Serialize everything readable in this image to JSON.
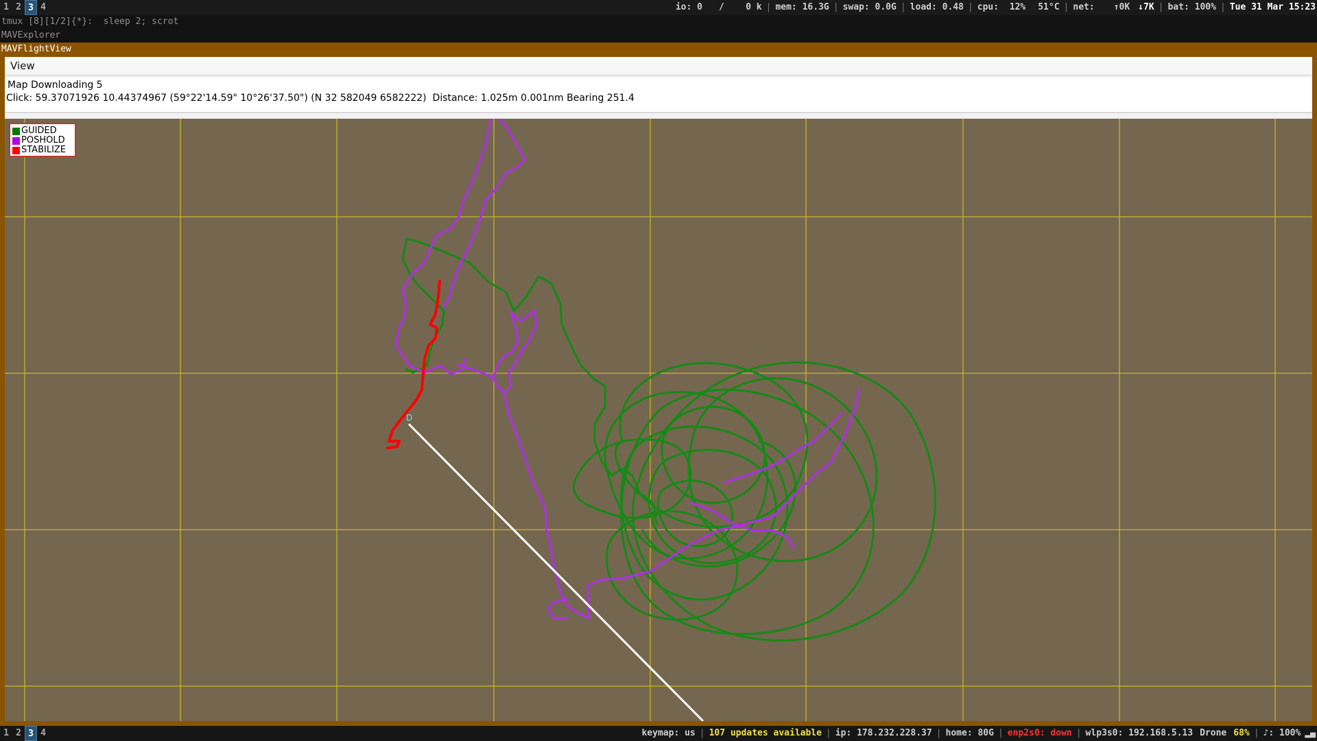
{
  "topbar": {
    "workspaces": [
      {
        "label": "1",
        "active": false
      },
      {
        "label": "2",
        "active": false
      },
      {
        "label": "3",
        "active": true
      },
      {
        "label": "4",
        "active": false
      }
    ],
    "io": "io: 0",
    "io_rate": "/    0 k",
    "mem": "mem: 16.3G",
    "swap": "swap: 0.0G",
    "load": "load: 0.48",
    "cpu": "cpu:  12%",
    "temp": "51°C",
    "net": "net:",
    "net_up": "↑0K",
    "net_down": "↓7K",
    "bat": "bat: 100%",
    "datetime": "Tue 31 Mar 15:23"
  },
  "tmux": {
    "line1": "tmux [8][1/2]{*}:  sleep 2; scrot",
    "line2": "MAVExplorer"
  },
  "window": {
    "title": "MAVFlightView"
  },
  "app": {
    "menu": [
      "View"
    ],
    "status_line1": "Map Downloading 5",
    "status_line2": "Click: 59.37071926 10.44374967 (59°22'14.59\" 10°26'37.50\") (N 32 582049 6582222)  Distance: 1.025m 0.001nm Bearing 251.4",
    "legend": [
      {
        "label": "GUIDED",
        "color": "#007a00"
      },
      {
        "label": "POSHOLD",
        "color": "#b000e8"
      },
      {
        "label": "STABILIZE",
        "color": "#ff0000"
      }
    ],
    "home_marker": "D",
    "colors": {
      "map_background": "#756650",
      "grid": "#f0e000",
      "guided": "#158a15",
      "poshold": "#b02ee8",
      "stabilize": "#ff0000",
      "click_line": "#ffffff"
    }
  },
  "bottombar": {
    "workspaces": [
      {
        "label": "1",
        "active": false
      },
      {
        "label": "2",
        "active": false
      },
      {
        "label": "3",
        "active": true
      },
      {
        "label": "4",
        "active": false
      }
    ],
    "keymap": "keymap: us",
    "updates": "107 updates available",
    "ip": "ip: 178.232.228.37",
    "home": "home: 80G",
    "enp": "enp2s0: down",
    "wlp": "wlp3s0: 192.168.5.13",
    "wifi_name": "Drone",
    "wifi_pct": "68%",
    "volume": "♪: 100%"
  }
}
